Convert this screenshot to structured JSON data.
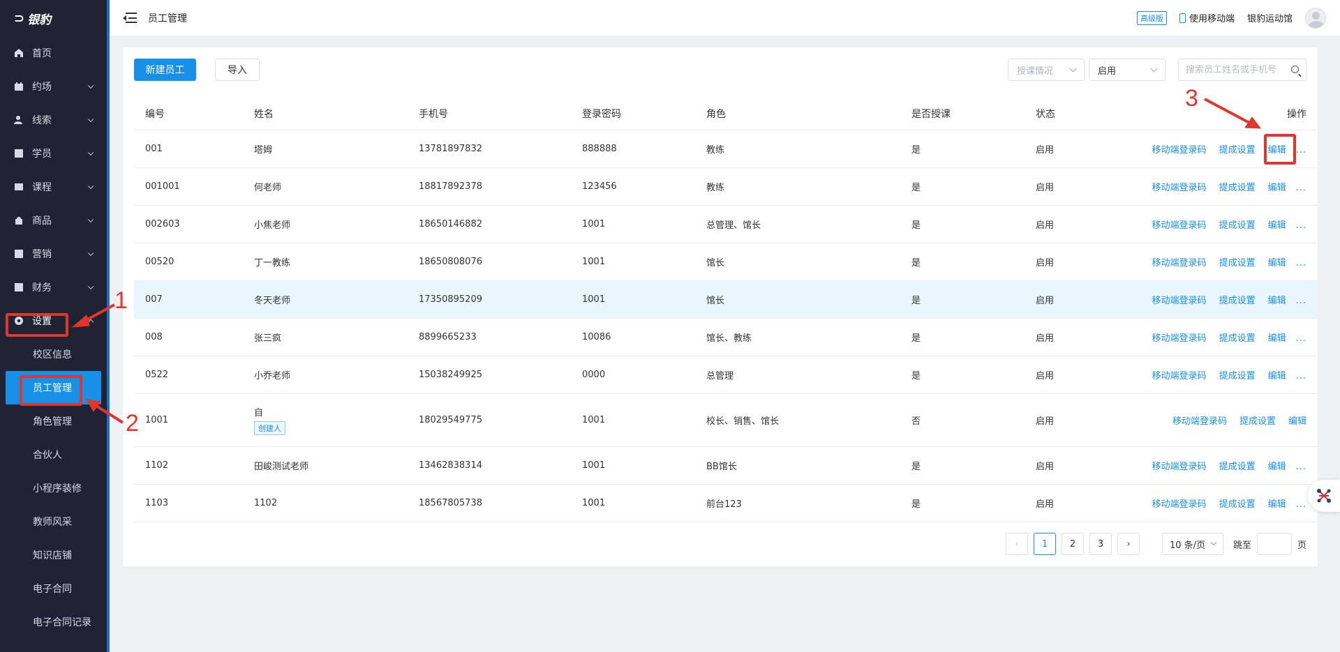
{
  "brand": {
    "name": "银豹"
  },
  "sidebar": {
    "items": [
      {
        "label": "首页",
        "icon": "home-icon"
      },
      {
        "label": "约场",
        "icon": "calendar-check-icon"
      },
      {
        "label": "线索",
        "icon": "user-icon"
      },
      {
        "label": "学员",
        "icon": "student-card-icon"
      },
      {
        "label": "课程",
        "icon": "course-icon"
      },
      {
        "label": "商品",
        "icon": "shopping-bag-icon"
      },
      {
        "label": "营销",
        "icon": "percent-icon"
      },
      {
        "label": "财务",
        "icon": "finance-icon"
      },
      {
        "label": "设置",
        "icon": "gear-icon"
      }
    ],
    "sub_items": [
      {
        "label": "校区信息"
      },
      {
        "label": "员工管理"
      },
      {
        "label": "角色管理"
      },
      {
        "label": "合伙人"
      },
      {
        "label": "小程序装修"
      },
      {
        "label": "教师风采"
      },
      {
        "label": "知识店铺"
      },
      {
        "label": "电子合同"
      },
      {
        "label": "电子合同记录"
      }
    ]
  },
  "header": {
    "title": "员工管理",
    "edition_badge": "高级版",
    "mobile_link": "使用移动端",
    "venue_name": "银豹运动馆"
  },
  "toolbar": {
    "new_button": "新建员工",
    "import_button": "导入",
    "teaching_filter_placeholder": "授课情况",
    "status_filter_value": "启用",
    "search_placeholder": "搜索员工姓名或手机号"
  },
  "table": {
    "columns": [
      "编号",
      "姓名",
      "手机号",
      "登录密码",
      "角色",
      "是否授课",
      "状态",
      "操作"
    ],
    "action_labels": {
      "mobile_login_code": "移动端登录码",
      "commission": "提成设置",
      "edit": "编辑",
      "more": "..."
    },
    "creator_tag": "创建人",
    "rows": [
      {
        "id": "001",
        "name": "塔姆",
        "phone": "13781897832",
        "password": "888888",
        "role": "教练",
        "teaches": "是",
        "status": "启用"
      },
      {
        "id": "001001",
        "name": "何老师",
        "phone": "18817892378",
        "password": "123456",
        "role": "教练",
        "teaches": "是",
        "status": "启用"
      },
      {
        "id": "002603",
        "name": "小焦老师",
        "phone": "18650146882",
        "password": "1001",
        "role": "总管理、馆长",
        "teaches": "是",
        "status": "启用"
      },
      {
        "id": "00520",
        "name": "丁一教练",
        "phone": "18650808076",
        "password": "1001",
        "role": "馆长",
        "teaches": "是",
        "status": "启用"
      },
      {
        "id": "007",
        "name": "冬天老师",
        "phone": "17350895209",
        "password": "1001",
        "role": "馆长",
        "teaches": "是",
        "status": "启用"
      },
      {
        "id": "008",
        "name": "张三疯",
        "phone": "8899665233",
        "password": "10086",
        "role": "馆长、教练",
        "teaches": "是",
        "status": "启用"
      },
      {
        "id": "0522",
        "name": "小乔老师",
        "phone": "15038249925",
        "password": "0000",
        "role": "总管理",
        "teaches": "是",
        "status": "启用"
      },
      {
        "id": "1001",
        "name": "自",
        "phone": "18029549775",
        "password": "1001",
        "role": "校长、销售、馆长",
        "teaches": "否",
        "status": "启用"
      },
      {
        "id": "1102",
        "name": "田峻测试老师",
        "phone": "13462838314",
        "password": "1001",
        "role": "BB馆长",
        "teaches": "是",
        "status": "启用"
      },
      {
        "id": "1103",
        "name": "1102",
        "phone": "18567805738",
        "password": "1001",
        "role": "前台123",
        "teaches": "是",
        "status": "启用"
      }
    ]
  },
  "pagination": {
    "pages": [
      "1",
      "2",
      "3"
    ],
    "current": "1",
    "page_size": "10 条/页",
    "jump_label": "跳至",
    "page_suffix": "页"
  },
  "annotations": {
    "labels": [
      "1",
      "2",
      "3"
    ],
    "color": "#e0362b"
  },
  "colors": {
    "primary": "#1890e8",
    "sidebar_bg": "#1f2333",
    "highlight_row": "#eaf6fd"
  }
}
